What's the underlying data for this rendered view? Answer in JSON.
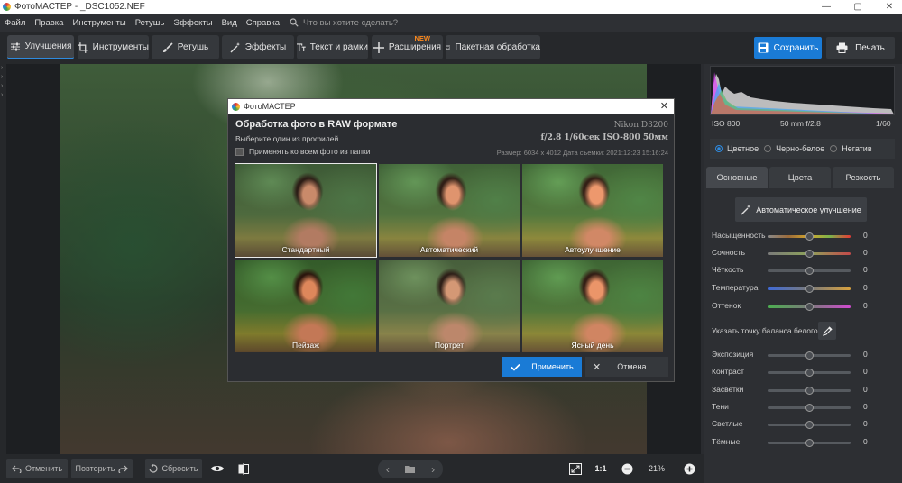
{
  "window": {
    "title": "ФотоМАСТЕР - _DSC1052.NEF"
  },
  "menu": {
    "items": [
      "Файл",
      "Правка",
      "Инструменты",
      "Ретушь",
      "Эффекты",
      "Вид",
      "Справка"
    ],
    "search_placeholder": "Что вы хотите сделать?"
  },
  "toolbar": {
    "tabs": [
      "Улучшения",
      "Инструменты",
      "Ретушь",
      "Эффекты",
      "Текст и рамки",
      "Расширения",
      "Пакетная обработка"
    ],
    "new_badge": "NEW",
    "save": "Сохранить",
    "print": "Печать"
  },
  "histogram": {
    "iso": "ISO 800",
    "lens": "50 mm f/2.8",
    "shutter": "1/60"
  },
  "modes": [
    "Цветное",
    "Черно-белое",
    "Негатив"
  ],
  "panel_tabs": [
    "Основные",
    "Цвета",
    "Резкость"
  ],
  "auto_enhance": "Автоматическое улучшение",
  "sliders_top": [
    {
      "label": "Насыщенность",
      "value": "0"
    },
    {
      "label": "Сочность",
      "value": "0"
    },
    {
      "label": "Чёткость",
      "value": "0"
    },
    {
      "label": "Температура",
      "value": "0"
    },
    {
      "label": "Оттенок",
      "value": "0"
    }
  ],
  "white_balance": "Указать точку баланса белого",
  "sliders_bottom": [
    {
      "label": "Экспозиция",
      "value": "0"
    },
    {
      "label": "Контраст",
      "value": "0"
    },
    {
      "label": "Засветки",
      "value": "0"
    },
    {
      "label": "Тени",
      "value": "0"
    },
    {
      "label": "Светлые",
      "value": "0"
    },
    {
      "label": "Тёмные",
      "value": "0"
    }
  ],
  "bottom": {
    "undo": "Отменить",
    "redo": "Повторить",
    "reset": "Сбросить",
    "ratio": "1:1",
    "zoom": "21%"
  },
  "dialog": {
    "title": "ФотоМАСТЕР",
    "heading": "Обработка фото в RAW формате",
    "camera": "Nikon D3200",
    "subtitle": "Выберите один из профилей",
    "exif": "f/2.8  1/60сек  ISO-800  50мм",
    "checkbox": "Применять ко всем фото из папки",
    "meta": "Размер: 6034 x 4012   Дата съемки: 2021:12:23  15:16:24",
    "profiles": [
      "Стандартный",
      "Автоматический",
      "Автоулучшение",
      "Пейзаж",
      "Портрет",
      "Ясный день"
    ],
    "apply": "Применить",
    "cancel": "Отмена"
  }
}
